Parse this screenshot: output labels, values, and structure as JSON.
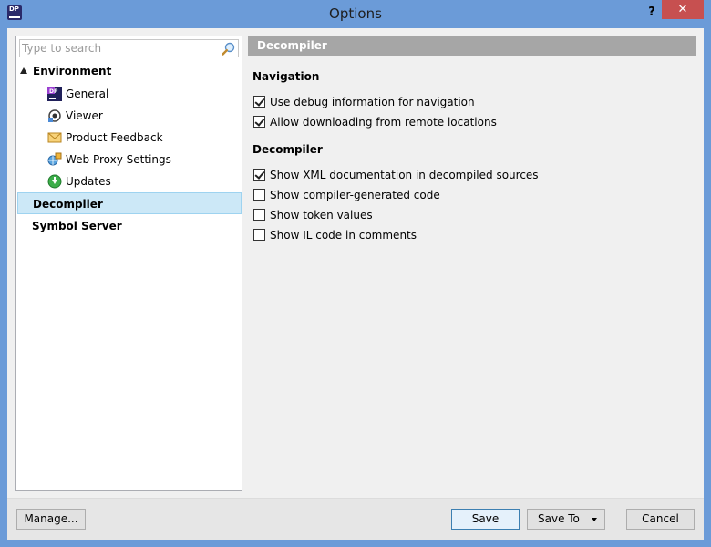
{
  "window": {
    "title": "Options",
    "app_icon_text": "DP",
    "help_label": "?",
    "close_label": "✕"
  },
  "search": {
    "placeholder": "Type to search",
    "value": ""
  },
  "tree": {
    "environment": "Environment",
    "children": [
      {
        "label": "General",
        "icon": "dotpeek-app-icon"
      },
      {
        "label": "Viewer",
        "icon": "viewer-icon"
      },
      {
        "label": "Product Feedback",
        "icon": "envelope-icon"
      },
      {
        "label": "Web Proxy Settings",
        "icon": "network-icon"
      },
      {
        "label": "Updates",
        "icon": "download-arrow-icon"
      }
    ],
    "decompiler": "Decompiler",
    "symbol_server": "Symbol Server"
  },
  "panel": {
    "header": "Decompiler",
    "navigation_heading": "Navigation",
    "navigation_options": [
      {
        "label": "Use debug information for navigation",
        "checked": true
      },
      {
        "label": "Allow downloading from remote locations",
        "checked": true
      }
    ],
    "decompiler_heading": "Decompiler",
    "decompiler_options": [
      {
        "label": "Show XML documentation in decompiled sources",
        "checked": true
      },
      {
        "label": "Show compiler-generated code",
        "checked": false
      },
      {
        "label": "Show token values",
        "checked": false
      },
      {
        "label": "Show IL code in comments",
        "checked": false
      }
    ]
  },
  "footer": {
    "manage": "Manage...",
    "save": "Save",
    "save_to": "Save To",
    "cancel": "Cancel"
  },
  "colors": {
    "titlebar": "#6b9bd8",
    "close_button": "#c75050",
    "selection": "#cce8f7",
    "header_bar": "#a6a6a6"
  }
}
